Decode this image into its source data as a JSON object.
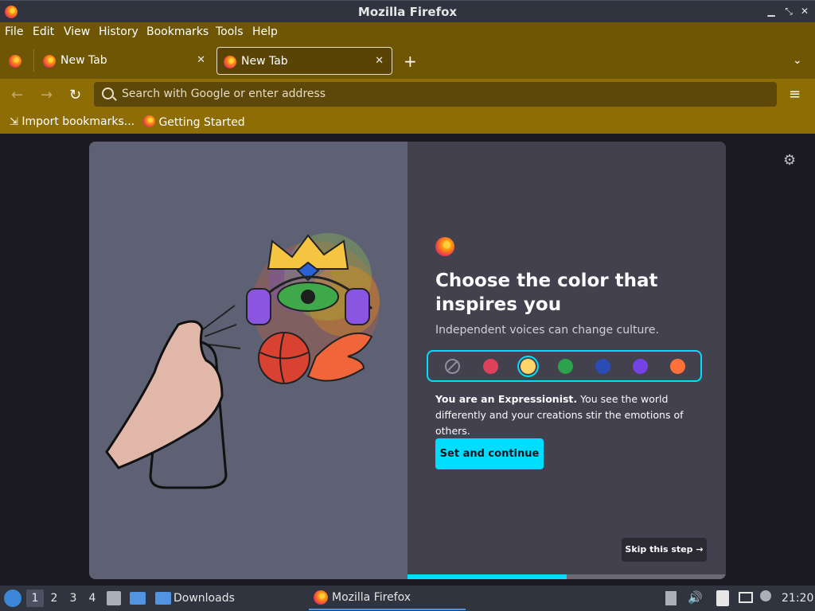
{
  "window": {
    "title": "Mozilla Firefox"
  },
  "menubar": {
    "items": [
      {
        "label": "File"
      },
      {
        "label": "Edit"
      },
      {
        "label": "View"
      },
      {
        "label": "History"
      },
      {
        "label": "Bookmarks"
      },
      {
        "label": "Tools"
      },
      {
        "label": "Help"
      }
    ]
  },
  "tabs": [
    {
      "label": "New Tab",
      "active": false
    },
    {
      "label": "New Tab",
      "active": true
    }
  ],
  "urlbar": {
    "placeholder": "Search with Google or enter address"
  },
  "bookmarks": [
    {
      "label": "Import bookmarks...",
      "icon": "import-icon"
    },
    {
      "label": "Getting Started",
      "icon": "firefox-icon"
    }
  ],
  "onboarding": {
    "headline": "Choose the color that inspires you",
    "subtitle": "Independent voices can change culture.",
    "selected_color_index": 2,
    "colors": [
      "none",
      "#e0415a",
      "#ffd567",
      "#2ca24e",
      "#2b4cb4",
      "#7542e5",
      "#ff7139"
    ],
    "description_bold": "You are an Expressionist.",
    "description_rest": " You see the world differently and your creations stir the emotions of others.",
    "cta": "Set and continue",
    "skip": "Skip this step →",
    "progress": 0.5
  },
  "taskbar": {
    "workspaces": [
      "1",
      "2",
      "3",
      "4"
    ],
    "active_workspace": "1",
    "downloads": "Downloads",
    "app": "Mozilla Firefox",
    "clock": "21:20"
  },
  "colors": {
    "accent": "#00ddff",
    "toolbar": "#8e6d06",
    "menubar": "#6f5605"
  }
}
